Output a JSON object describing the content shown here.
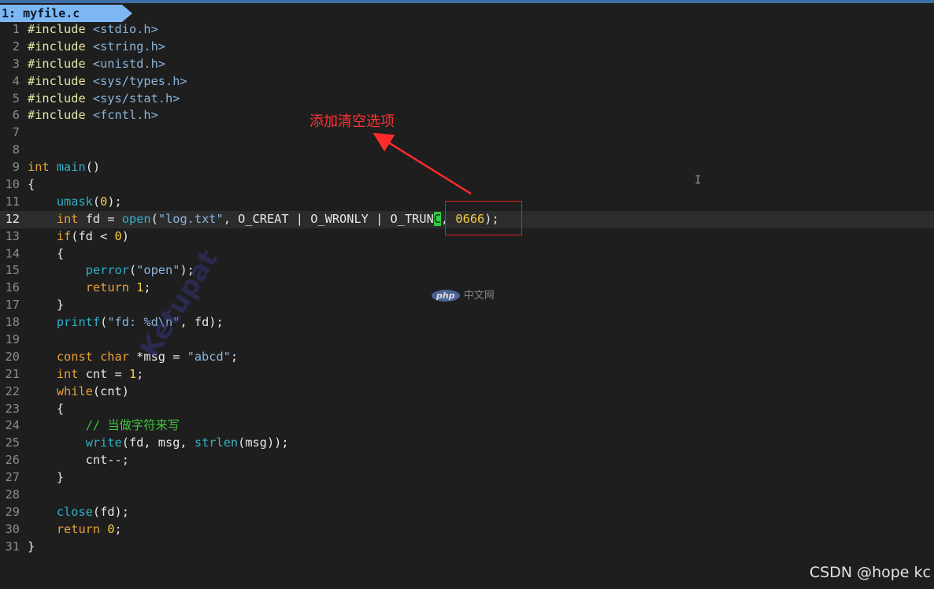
{
  "tab": {
    "label": "1: myfile.c"
  },
  "editor": {
    "current_line": 12,
    "lines": [
      {
        "n": "1",
        "t": [
          [
            "pp",
            "#include "
          ],
          [
            "s",
            "<stdio.h>"
          ]
        ]
      },
      {
        "n": "2",
        "t": [
          [
            "pp",
            "#include "
          ],
          [
            "s",
            "<string.h>"
          ]
        ]
      },
      {
        "n": "3",
        "t": [
          [
            "pp",
            "#include "
          ],
          [
            "s",
            "<unistd.h>"
          ]
        ]
      },
      {
        "n": "4",
        "t": [
          [
            "pp",
            "#include "
          ],
          [
            "s",
            "<sys/types.h>"
          ]
        ]
      },
      {
        "n": "5",
        "t": [
          [
            "pp",
            "#include "
          ],
          [
            "s",
            "<sys/stat.h>"
          ]
        ]
      },
      {
        "n": "6",
        "t": [
          [
            "pp",
            "#include "
          ],
          [
            "s",
            "<fcntl.h>"
          ]
        ]
      },
      {
        "n": "7",
        "t": []
      },
      {
        "n": "8",
        "t": []
      },
      {
        "n": "9",
        "t": [
          [
            "k",
            "int "
          ],
          [
            "f",
            "main"
          ],
          [
            "p",
            "()"
          ]
        ]
      },
      {
        "n": "10",
        "t": [
          [
            "p",
            "{"
          ]
        ]
      },
      {
        "n": "11",
        "t": [
          [
            "p",
            "    "
          ],
          [
            "f",
            "umask"
          ],
          [
            "p",
            "("
          ],
          [
            "n",
            "0"
          ],
          [
            "p",
            ");"
          ]
        ]
      },
      {
        "n": "12",
        "t": [
          [
            "p",
            "    "
          ],
          [
            "k",
            "int "
          ],
          [
            "p",
            "fd = "
          ],
          [
            "f",
            "open"
          ],
          [
            "p",
            "("
          ],
          [
            "s",
            "\"log.txt\""
          ],
          [
            "p",
            ", O_CREAT | O_WRONLY | O_TRUN"
          ],
          [
            "cursor",
            "C"
          ],
          [
            "p",
            ", "
          ],
          [
            "n",
            "0666"
          ],
          [
            "p",
            ");"
          ]
        ]
      },
      {
        "n": "13",
        "t": [
          [
            "p",
            "    "
          ],
          [
            "k",
            "if"
          ],
          [
            "p",
            "(fd < "
          ],
          [
            "n",
            "0"
          ],
          [
            "p",
            ")"
          ]
        ]
      },
      {
        "n": "14",
        "t": [
          [
            "p",
            "    {"
          ]
        ]
      },
      {
        "n": "15",
        "t": [
          [
            "p",
            "        "
          ],
          [
            "f",
            "perror"
          ],
          [
            "p",
            "("
          ],
          [
            "s",
            "\"open\""
          ],
          [
            "p",
            ");"
          ]
        ]
      },
      {
        "n": "16",
        "t": [
          [
            "p",
            "        "
          ],
          [
            "k",
            "return "
          ],
          [
            "n",
            "1"
          ],
          [
            "p",
            ";"
          ]
        ]
      },
      {
        "n": "17",
        "t": [
          [
            "p",
            "    }"
          ]
        ]
      },
      {
        "n": "18",
        "t": [
          [
            "p",
            "    "
          ],
          [
            "f",
            "printf"
          ],
          [
            "p",
            "("
          ],
          [
            "s",
            "\"fd: %d\\n\""
          ],
          [
            "p",
            ", fd);"
          ]
        ]
      },
      {
        "n": "19",
        "t": []
      },
      {
        "n": "20",
        "t": [
          [
            "p",
            "    "
          ],
          [
            "k",
            "const char "
          ],
          [
            "p",
            "*msg = "
          ],
          [
            "s",
            "\"abcd\""
          ],
          [
            "p",
            ";"
          ]
        ]
      },
      {
        "n": "21",
        "t": [
          [
            "p",
            "    "
          ],
          [
            "k",
            "int "
          ],
          [
            "p",
            "cnt = "
          ],
          [
            "n",
            "1"
          ],
          [
            "p",
            ";"
          ]
        ]
      },
      {
        "n": "22",
        "t": [
          [
            "p",
            "    "
          ],
          [
            "k",
            "while"
          ],
          [
            "p",
            "(cnt)"
          ]
        ]
      },
      {
        "n": "23",
        "t": [
          [
            "p",
            "    {"
          ]
        ]
      },
      {
        "n": "24",
        "t": [
          [
            "p",
            "        "
          ],
          [
            "c",
            "// 当做字符来写"
          ]
        ]
      },
      {
        "n": "25",
        "t": [
          [
            "p",
            "        "
          ],
          [
            "f",
            "write"
          ],
          [
            "p",
            "(fd, msg, "
          ],
          [
            "f",
            "strlen"
          ],
          [
            "p",
            "(msg));"
          ]
        ]
      },
      {
        "n": "26",
        "t": [
          [
            "p",
            "        cnt--;"
          ]
        ]
      },
      {
        "n": "27",
        "t": [
          [
            "p",
            "    }"
          ]
        ]
      },
      {
        "n": "28",
        "t": []
      },
      {
        "n": "29",
        "t": [
          [
            "p",
            "    "
          ],
          [
            "f",
            "close"
          ],
          [
            "p",
            "(fd);"
          ]
        ]
      },
      {
        "n": "30",
        "t": [
          [
            "p",
            "    "
          ],
          [
            "k",
            "return "
          ],
          [
            "n",
            "0"
          ],
          [
            "p",
            ";"
          ]
        ]
      },
      {
        "n": "31",
        "t": [
          [
            "p",
            "}"
          ]
        ]
      }
    ]
  },
  "annotation": {
    "text": "添加清空选项",
    "color": "#ff3232"
  },
  "watermark": {
    "logo": "php",
    "text": "中文网"
  },
  "stamp": {
    "text": "Ketupat"
  },
  "cursor_glyph": "I",
  "credit": {
    "text": "CSDN @hope kc"
  }
}
